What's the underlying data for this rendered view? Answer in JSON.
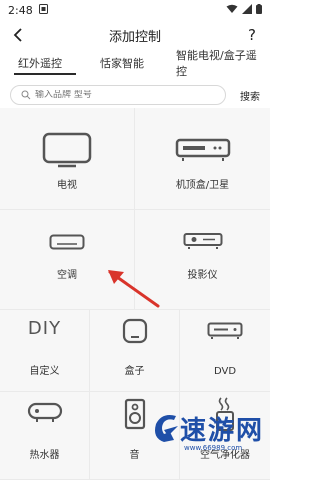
{
  "status": {
    "time": "2:48"
  },
  "header": {
    "title": "添加控制",
    "help": "?"
  },
  "tabs": [
    {
      "label": "红外遥控",
      "active": true
    },
    {
      "label": "恬家智能",
      "active": false
    },
    {
      "label": "智能电视/盒子遥控",
      "active": false
    }
  ],
  "search": {
    "placeholder": "输入品牌 型号",
    "button": "搜索"
  },
  "devices": {
    "tv": "电视",
    "stb": "机顶盒/卫星",
    "ac": "空调",
    "projector": "投影仪",
    "custom": "自定义",
    "custom_icon_text": "DIY",
    "box": "盒子",
    "dvd": "DVD",
    "water_heater": "热水器",
    "speaker": "音",
    "air_purifier": "空气净化器"
  },
  "watermark": {
    "brand": "速游网",
    "url": "www.66989.com"
  },
  "colors": {
    "accent": "#2a2a2a",
    "arrow": "#d9342b",
    "watermark": "#1f4fa8"
  }
}
